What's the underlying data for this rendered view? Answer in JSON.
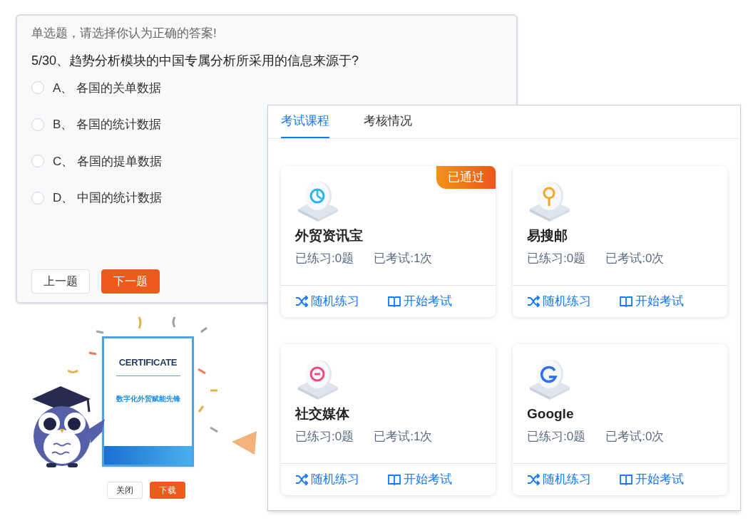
{
  "quiz": {
    "instruction": "单选题，请选择你认为正确的答案!",
    "question": "5/30、趋势分析模块的中国专属分析所采用的信息来源于?",
    "options": [
      {
        "text": "A、 各国的关单数据",
        "selected": false
      },
      {
        "text": "B、 各国的统计数据",
        "selected": false
      },
      {
        "text": "C、 各国的提单数据",
        "selected": false
      },
      {
        "text": "D、 中国的统计数据",
        "selected": false
      }
    ],
    "buttons": [
      {
        "label": "上一题",
        "kind": "secondary"
      },
      {
        "label": "下一题",
        "kind": "primary"
      }
    ]
  },
  "certificate": {
    "heading": "CERTIFICATE",
    "title": "数字化外贸赋能先锋",
    "buttons": [
      {
        "label": "关闭",
        "kind": "secondary"
      },
      {
        "label": "下载",
        "kind": "primary"
      }
    ]
  },
  "courses": {
    "tabs": [
      {
        "label": "考试课程",
        "selected": true
      },
      {
        "label": "考核情况",
        "selected": false
      }
    ],
    "cards": [
      {
        "name": "外贸资讯宝",
        "badge": "已通过",
        "practiced": "已练习:0题",
        "exams": "已考试:1次",
        "actions": [
          {
            "label": "随机练习",
            "kind": "random"
          },
          {
            "label": "开始考试",
            "kind": "exam"
          }
        ]
      },
      {
        "name": "易搜邮",
        "practiced": "已练习:0题",
        "exams": "已考试:0次",
        "actions": [
          {
            "label": "随机练习",
            "kind": "random"
          },
          {
            "label": "开始考试",
            "kind": "exam"
          }
        ]
      },
      {
        "name": "社交媒体",
        "practiced": "已练习:0题",
        "exams": "已考试:1次",
        "actions": [
          {
            "label": "随机练习",
            "kind": "random"
          },
          {
            "label": "开始考试",
            "kind": "exam"
          }
        ]
      },
      {
        "name": "Google",
        "practiced": "已练习:0题",
        "exams": "已考试:0次",
        "actions": [
          {
            "label": "随机练习",
            "kind": "random"
          },
          {
            "label": "开始考试",
            "kind": "exam"
          }
        ]
      }
    ]
  }
}
